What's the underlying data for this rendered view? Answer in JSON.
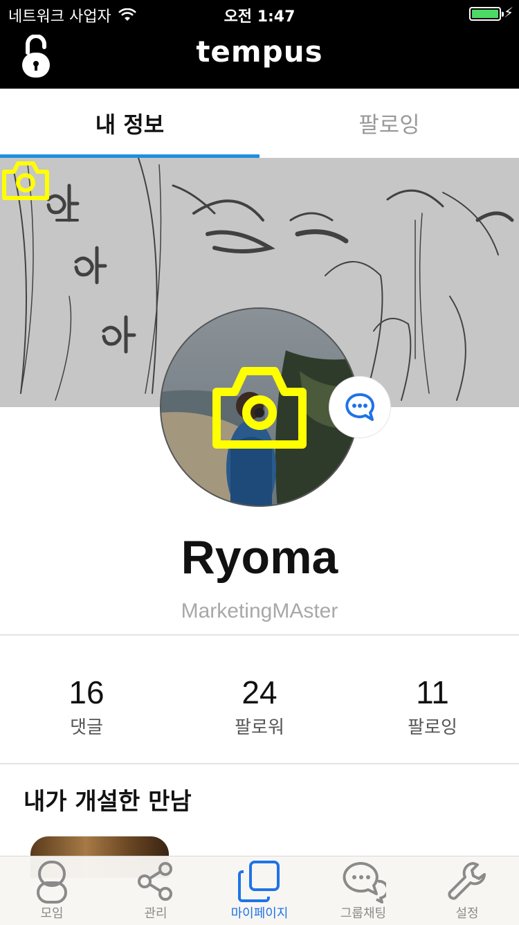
{
  "status_bar": {
    "carrier": "네트워크 사업자",
    "time": "오전 1:47",
    "battery_level": 1.0,
    "battery_color": "#4cd964"
  },
  "header": {
    "title": "tempus",
    "lock_icon": "unlocked-padlock-icon"
  },
  "tabs": [
    {
      "label": "내 정보",
      "active": true
    },
    {
      "label": "팔로잉",
      "active": false
    }
  ],
  "accent_color": "#1e8fe0",
  "camera_icon_color": "#ffff00",
  "profile": {
    "name": "Ryoma",
    "subtitle": "MarketingMAster"
  },
  "stats": [
    {
      "value": "16",
      "label": "댓글"
    },
    {
      "value": "24",
      "label": "팔로워"
    },
    {
      "value": "11",
      "label": "팔로잉"
    }
  ],
  "section": {
    "title": "내가 개설한 만남"
  },
  "tabbar": [
    {
      "label": "모임",
      "icon": "person-icon",
      "active": false
    },
    {
      "label": "관리",
      "icon": "share-icon",
      "active": false
    },
    {
      "label": "마이페이지",
      "icon": "pages-icon",
      "active": true
    },
    {
      "label": "그룹채팅",
      "icon": "chat-bubbles-icon",
      "active": false
    },
    {
      "label": "설정",
      "icon": "wrench-icon",
      "active": false
    }
  ]
}
